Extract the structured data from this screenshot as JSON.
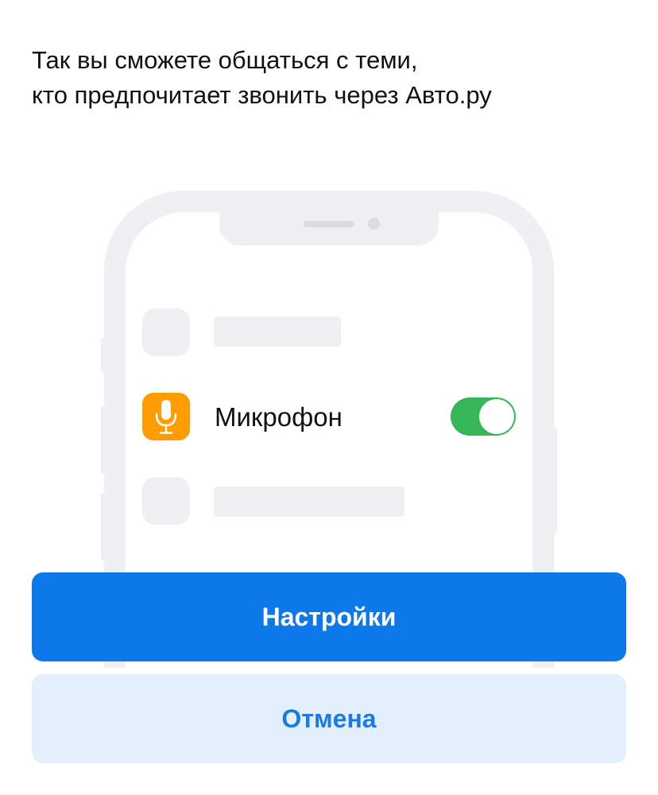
{
  "description": {
    "line1": "Так вы сможете общаться с теми,",
    "line2": "кто предпочитает звонить через Авто.ру"
  },
  "illustration": {
    "setting_label": "Микрофон",
    "setting_enabled": true,
    "icon": "microphone-icon",
    "colors": {
      "mic_icon_bg": "#fe9c00",
      "toggle_on": "#35b657",
      "placeholder": "#f0f0f2"
    }
  },
  "actions": {
    "settings_label": "Настройки",
    "cancel_label": "Отмена",
    "colors": {
      "primary_bg": "#0d78ea",
      "primary_text": "#ffffff",
      "secondary_bg": "#e2effc",
      "secondary_text": "#1a7be6"
    }
  }
}
